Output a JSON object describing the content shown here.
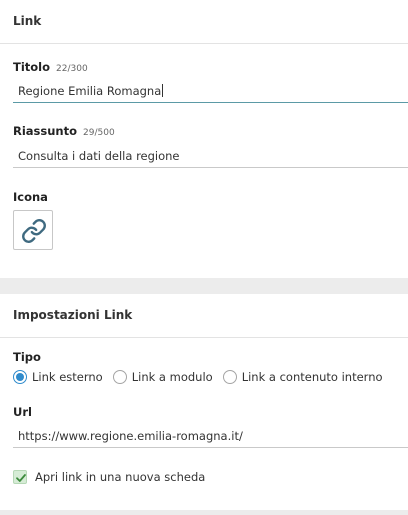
{
  "link_panel": {
    "title": "Link",
    "titolo": {
      "label": "Titolo",
      "count": "22/300",
      "value": "Regione Emilia Romagna"
    },
    "riassunto": {
      "label": "Riassunto",
      "count": "29/500",
      "value": "Consulta i dati della regione"
    },
    "icona": {
      "label": "Icona",
      "icon": "link-icon"
    }
  },
  "settings_panel": {
    "title": "Impostazioni Link",
    "tipo": {
      "label": "Tipo",
      "options": [
        {
          "label": "Link esterno",
          "checked": true
        },
        {
          "label": "Link a modulo",
          "checked": false
        },
        {
          "label": "Link a contenuto interno",
          "checked": false
        }
      ]
    },
    "url": {
      "label": "Url",
      "value": "https://www.regione.emilia-romagna.it/"
    },
    "new_tab": {
      "label": "Apri link in una nuova scheda",
      "checked": true
    }
  },
  "colors": {
    "page_bg": "#ececec",
    "panel_bg": "#ffffff",
    "radio_accent": "#2f8bcc",
    "focus_underline": "#5b9aa6",
    "checkbox_bg": "#d6ecd6",
    "checkmark": "#3c8a3c"
  }
}
